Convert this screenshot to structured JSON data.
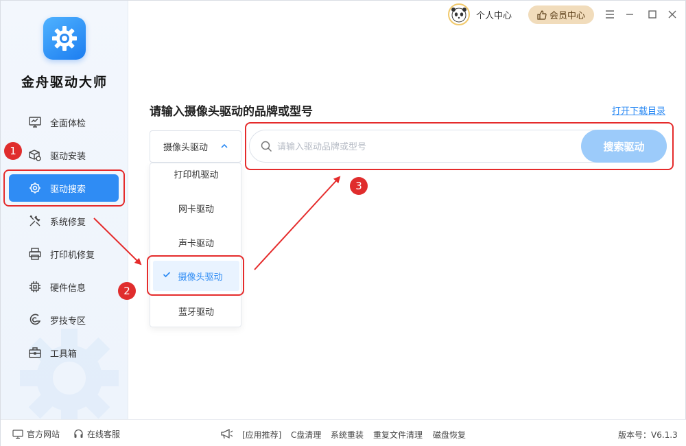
{
  "app": {
    "name": "金舟驱动大师"
  },
  "titlebar": {
    "user_center": "个人中心",
    "vip": "会员中心"
  },
  "sidebar": {
    "items": [
      {
        "label": "全面体检",
        "icon": "monitor-icon"
      },
      {
        "label": "驱动安装",
        "icon": "package-gear-icon"
      },
      {
        "label": "驱动搜索",
        "icon": "search-gear-icon",
        "active": true
      },
      {
        "label": "系统修复",
        "icon": "wrench-icon"
      },
      {
        "label": "打印机修复",
        "icon": "printer-icon"
      },
      {
        "label": "硬件信息",
        "icon": "chip-icon"
      },
      {
        "label": "罗技专区",
        "icon": "logitech-icon"
      },
      {
        "label": "工具箱",
        "icon": "toolbox-icon"
      }
    ]
  },
  "main": {
    "heading": "请输入摄像头驱动的品牌或型号",
    "download_link": "打开下载目录",
    "select": {
      "value": "摄像头驱动",
      "options": [
        "打印机驱动",
        "网卡驱动",
        "声卡驱动",
        "摄像头驱动",
        "蓝牙驱动"
      ],
      "selected_index": 3
    },
    "search": {
      "placeholder": "请输入驱动品牌或型号",
      "button": "搜索驱动"
    }
  },
  "annotations": [
    "1",
    "2",
    "3"
  ],
  "footer": {
    "official_site": "官方网站",
    "online_service": "在线客服",
    "recommend": "[应用推荐]",
    "links": [
      "C盘清理",
      "系统重装",
      "重复文件清理",
      "磁盘恢复"
    ],
    "version": "版本号：V6.1.3"
  },
  "colors": {
    "accent": "#2f8cf4",
    "search_button": "#9ccbfa",
    "annotation_red": "#e52b2b",
    "vip_bg": "#f1dcbb"
  }
}
